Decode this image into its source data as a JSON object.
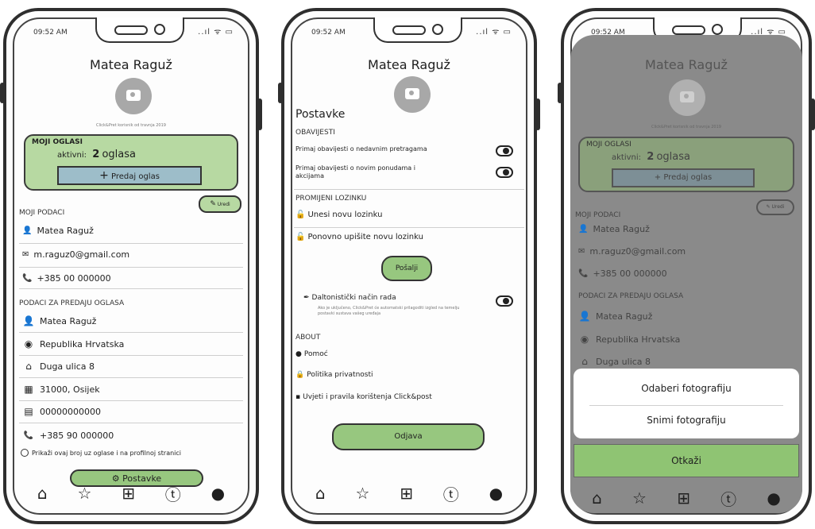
{
  "status": {
    "time": "09:52 AM",
    "icons": "..ıl ᯤ ▭"
  },
  "profile": {
    "name": "Matea Raguž",
    "member_since": "Click&Pret korisnik od travnja 2019"
  },
  "my_ads": {
    "title": "MOJI OGLASI",
    "active_label": "aktivni:",
    "active_count": "2",
    "active_unit": "oglasa",
    "sell_button": "Predaj oglas"
  },
  "edit_label": "Uredi",
  "my_data": {
    "title": "MOJI PODACI",
    "name": "Matea Raguž",
    "email": "m.raguz0@gmail.com",
    "phone": "+385 00 000000"
  },
  "sell_data": {
    "title": "PODACI ZA PREDAJU OGLASA",
    "name": "Matea Raguž",
    "country": "Republika Hrvatska",
    "street": "Duga ulica 8",
    "city": "31000, Osijek",
    "id_number": "00000000000",
    "phone": "+385 90 000000",
    "show_phone": "Prikaži ovaj broj uz oglase i na profilnoj stranici"
  },
  "settings_button": "Postavke",
  "settings": {
    "title": "Postavke",
    "notifications_title": "OBAVIJESTI",
    "notif_recent": "Primaj obavijesti o nedavnim pretragama",
    "notif_offers": "Primaj obavijesti o novim ponudama i akcijama",
    "password_title": "PROMIJENI LOZINKU",
    "new_password": "Unesi novu lozinku",
    "repeat_password": "Ponovno upišite novu lozinku",
    "send_button": "Pošalji",
    "colorblind_title": "Daltonistički način rada",
    "colorblind_desc": "Ako je uključeno, Click&Pret će automatski prilagoditi izgled na temelju postavki sustava vašeg uređaja",
    "about_title": "ABOUT",
    "help": "Pomoć",
    "privacy": "Politika privatnosti",
    "terms": "Uvjeti i pravila korištenja Click&post",
    "logout_button": "Odjava"
  },
  "photo_sheet": {
    "choose": "Odaberi fotografiju",
    "take": "Snimi fotografiju",
    "cancel": "Otkaži"
  },
  "nav": {
    "home": "⌂",
    "favorites": "☆",
    "add": "⊞",
    "chat": "ⓣ",
    "profile": "●"
  },
  "colors": {
    "accent_green": "#b7d9a2",
    "button_green": "#97c77f",
    "sell_button_blue": "#9dbdc9",
    "overlay_gray": "#8a8a8a"
  }
}
